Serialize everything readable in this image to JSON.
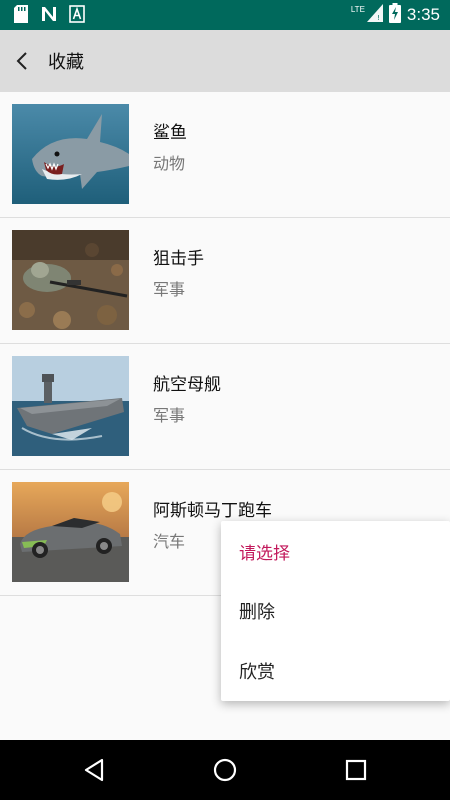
{
  "status_bar": {
    "time": "3:35",
    "network": "LTE",
    "left_icons": [
      "sd-card-icon",
      "n-notification-icon",
      "a-notification-icon"
    ],
    "background": "#00695c"
  },
  "toolbar": {
    "title": "收藏",
    "background": "#dcdcdc"
  },
  "favorites": [
    {
      "title": "鲨鱼",
      "category": "动物",
      "image": "shark-image"
    },
    {
      "title": "狙击手",
      "category": "军事",
      "image": "sniper-image"
    },
    {
      "title": "航空母舰",
      "category": "军事",
      "image": "aircraft-carrier-image"
    },
    {
      "title": "阿斯顿马丁跑车",
      "category": "汽车",
      "image": "sports-car-image"
    }
  ],
  "context_menu": {
    "header": "请选择",
    "items": [
      "删除",
      "欣赏"
    ],
    "accent": "#c2185b"
  },
  "nav_bar": {
    "buttons": [
      "back-triangle-icon",
      "home-circle-icon",
      "recents-square-icon"
    ]
  }
}
